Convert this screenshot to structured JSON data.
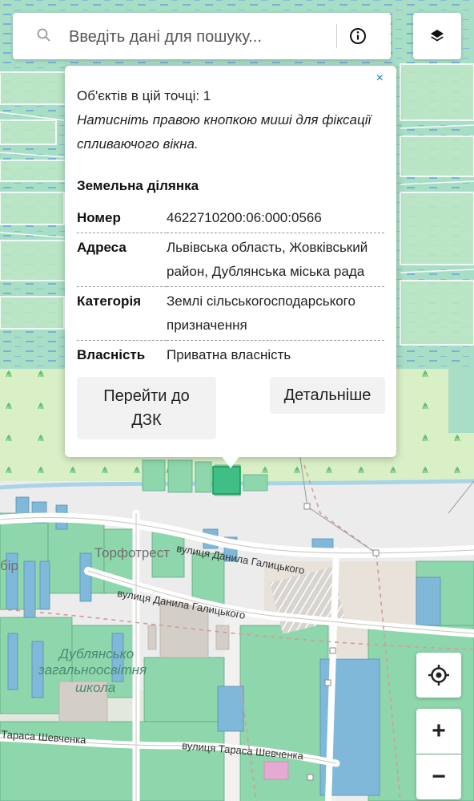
{
  "search": {
    "placeholder": "Введіть дані для пошуку..."
  },
  "icons": {
    "search": "search-icon",
    "info": "info-icon",
    "layers": "layers-icon",
    "close": "close-icon",
    "locate": "locate-icon",
    "zoom_in": "plus-icon",
    "zoom_out": "minus-icon"
  },
  "popup": {
    "close_symbol": "×",
    "objects_count": "Об'єктів в цій точці: 1",
    "hint": "Натисніть правою кнопкою миші для фіксації спливаючого вікна.",
    "parcel_title": "Земельна ділянка",
    "rows": [
      {
        "key": "Номер",
        "value": "4622710200:06:000:0566"
      },
      {
        "key": "Адреса",
        "value": "Львівська область, Жовківський район, Дублянська міська рада"
      },
      {
        "key": "Категорія",
        "value": "Землі сільськогосподарського призначення"
      },
      {
        "key": "Власність",
        "value": "Приватна власність"
      }
    ],
    "button_dzk": "Перейти до ДЗК",
    "button_details": "Детальніше"
  },
  "controls": {
    "zoom_in": "+",
    "zoom_out": "−"
  },
  "map_labels": {
    "torfotrest": "Торфотрест",
    "street_halytskoho_1": "вулиця Данила Галицького",
    "street_halytskoho_2": "вулиця Данила Галицького",
    "school_1": "Дублянсько",
    "school_2": "загальноосвітня",
    "school_3": "школа",
    "street_shevchenka_1": "Тараса Шевченка",
    "street_shevchenka_2": "вулиця Тараса Шевченка",
    "fragment_left": "бір"
  },
  "colors": {
    "meadow": "#d6ecc4",
    "parcel_green": "#8ed6ab",
    "parcel_blue": "#7fb8d8",
    "town_bg": "#ececec",
    "accent": "#0a7fc2"
  }
}
